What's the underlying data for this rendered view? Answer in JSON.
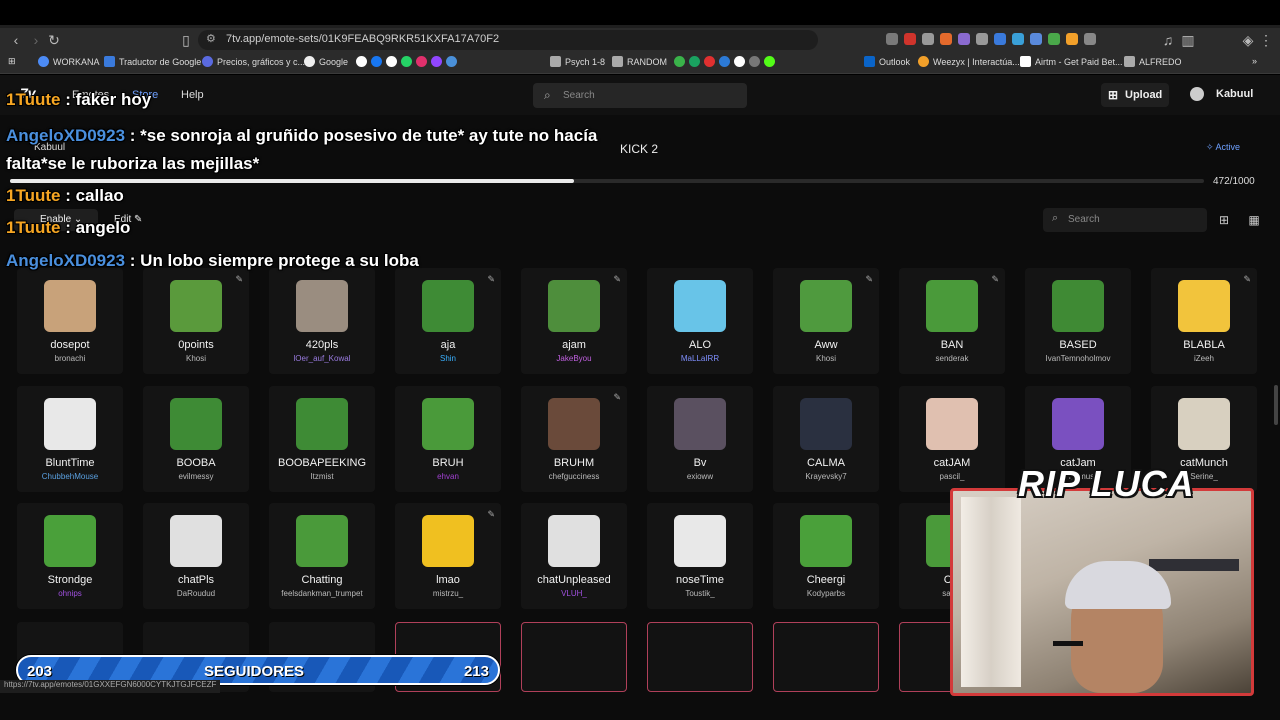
{
  "browser": {
    "url": "7tv.app/emote-sets/01K9FEABQ9RKR51KXFA17A70F2",
    "bookmarks": [
      "WORKANA",
      "Traductor de Google",
      "Precios, gráficos y c...",
      "Google",
      "Psych 1-8",
      "RANDOM",
      "Outlook",
      "Weezyx | Interactúa...",
      "Airtm - Get Paid Bet...",
      "ALFREDO"
    ],
    "status_url": "https://7tv.app/emotes/01GXXEFGN6000CYTKJTGJFCEZF"
  },
  "site": {
    "logo": "7v",
    "nav": [
      "Emotes",
      "Store",
      "Help"
    ],
    "search_placeholder": "Search",
    "upload_label": "Upload",
    "username": "Kabuul"
  },
  "emote_set": {
    "owner": "Kabuul",
    "title": "KICK 2",
    "active_label": "Active",
    "capacity_label": "472/1000",
    "capacity_fraction": 0.472,
    "enable_label": "Enable",
    "edit_label": "Edit",
    "search_placeholder": "Search"
  },
  "emotes": [
    {
      "name": "dosepot",
      "author": "bronachi",
      "color": "#c8a27a",
      "author_color": "#bbbbbb",
      "edit": false
    },
    {
      "name": "0points",
      "author": "Khosi",
      "color": "#5a9a3c",
      "author_color": "#bbbbbb",
      "edit": true
    },
    {
      "name": "420pls",
      "author": "lOer_auf_Kowal",
      "color": "#9a8d80",
      "author_color": "#9a7be0",
      "edit": false
    },
    {
      "name": "aja",
      "author": "Shin",
      "color": "#3e8b35",
      "author_color": "#3ab0ff",
      "edit": true
    },
    {
      "name": "ajam",
      "author": "JakeByou",
      "color": "#4e8e3c",
      "author_color": "#c060e0",
      "edit": true
    },
    {
      "name": "ALO",
      "author": "MaLLaIRR",
      "color": "#68c4e8",
      "author_color": "#8090ff",
      "edit": false
    },
    {
      "name": "Aww",
      "author": "Khosi",
      "color": "#4f9a3e",
      "author_color": "#bbbbbb",
      "edit": true
    },
    {
      "name": "BAN",
      "author": "senderak",
      "color": "#4a9a3a",
      "author_color": "#bbbbbb",
      "edit": true
    },
    {
      "name": "BASED",
      "author": "IvanTemnoholmov",
      "color": "#3f8a34",
      "author_color": "#bbbbbb",
      "edit": false
    },
    {
      "name": "BLABLA",
      "author": "iZeeh",
      "color": "#f2c43c",
      "author_color": "#bbbbbb",
      "edit": true
    },
    {
      "name": "BluntTime",
      "author": "ChubbehMouse",
      "color": "#e8e8e8",
      "author_color": "#5aa0e0",
      "edit": false
    },
    {
      "name": "BOOBA",
      "author": "evilmessy",
      "color": "#3e8b35",
      "author_color": "#bbbbbb",
      "edit": false
    },
    {
      "name": "BOOBAPEEKING",
      "author": "Itzmist",
      "color": "#3e8b35",
      "author_color": "#bbbbbb",
      "edit": false
    },
    {
      "name": "BRUH",
      "author": "ehvan",
      "color": "#4a9a3a",
      "author_color": "#a040d0",
      "edit": false
    },
    {
      "name": "BRUHM",
      "author": "chefgucciness",
      "color": "#6a4a3a",
      "author_color": "#bbbbbb",
      "edit": true
    },
    {
      "name": "Bv",
      "author": "exioww",
      "color": "#5a5060",
      "author_color": "#bbbbbb",
      "edit": false
    },
    {
      "name": "CALMA",
      "author": "Krayevsky7",
      "color": "#2a3040",
      "author_color": "#bbbbbb",
      "edit": false
    },
    {
      "name": "catJAM",
      "author": "pascil_",
      "color": "#e0c0b0",
      "author_color": "#bbbbbb",
      "edit": false
    },
    {
      "name": "catJam",
      "author": "enyomus",
      "color": "#7a50c0",
      "author_color": "#bbbbbb",
      "edit": false
    },
    {
      "name": "catMunch",
      "author": "Serine_",
      "color": "#d8d0c0",
      "author_color": "#bbbbbb",
      "edit": false
    },
    {
      "name": "Strondge",
      "author": "ohnips",
      "color": "#4aa03a",
      "author_color": "#a050e0",
      "edit": false
    },
    {
      "name": "chatPls",
      "author": "DaRoudud",
      "color": "#e0e0e0",
      "author_color": "#bbbbbb",
      "edit": false
    },
    {
      "name": "Chatting",
      "author": "feelsdankman_trumpet",
      "color": "#4a9a3a",
      "author_color": "#bbbbbb",
      "edit": false
    },
    {
      "name": "lmao",
      "author": "mistrzu_",
      "color": "#f0c020",
      "author_color": "#bbbbbb",
      "edit": true
    },
    {
      "name": "chatUnpleased",
      "author": "VLUH_",
      "color": "#e0e0e0",
      "author_color": "#a050e0",
      "edit": false
    },
    {
      "name": "noseTime",
      "author": "Toustik_",
      "color": "#e8e8e8",
      "author_color": "#bbbbbb",
      "edit": false
    },
    {
      "name": "Cheergi",
      "author": "Kodyparbs",
      "color": "#4aa03a",
      "author_color": "#bbbbbb",
      "edit": false
    },
    {
      "name": "Col",
      "author": "samn",
      "color": "#4a9a3a",
      "author_color": "#bbbbbb",
      "edit": false
    }
  ],
  "chat": [
    {
      "user": "1Tuute",
      "text": ": faker hoy",
      "user_color": "#f6a623"
    },
    {
      "user": "AngeloXD0923",
      "text": ": *se sonroja al gruñido posesivo de tute* ay tute no hacía",
      "user_color": "#4a8fdd"
    },
    {
      "user": "",
      "text": "falta*se le ruboriza las mejillas*",
      "user_color": "#4a8fdd"
    },
    {
      "user": "1Tuute",
      "text": ": callao",
      "user_color": "#f6a623"
    },
    {
      "user": "1Tuute",
      "text": ": angelo",
      "user_color": "#f6a623"
    },
    {
      "user": "AngeloXD0923",
      "text": ": Un lobo siempre protege a su loba",
      "user_color": "#4a8fdd"
    }
  ],
  "overlay": {
    "rip_text": "RIP LUCA",
    "followers_current": "203",
    "followers_label": "SEGUIDORES",
    "followers_goal": "213"
  }
}
